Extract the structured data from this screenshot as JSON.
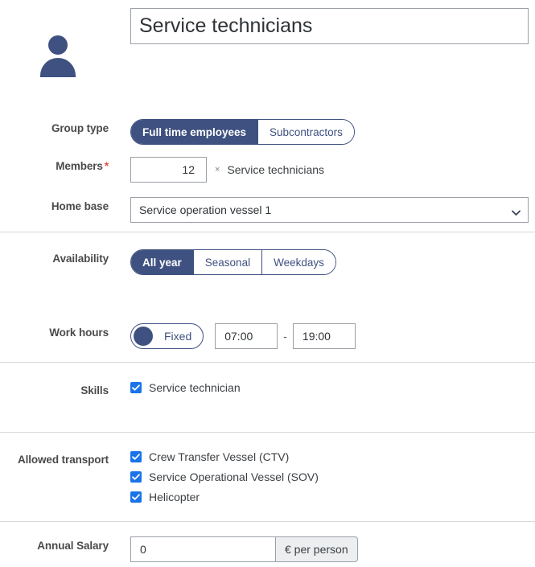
{
  "header": {
    "avatar_icon": "person-icon",
    "group_name": "Service technicians"
  },
  "fields": {
    "group_type": {
      "label": "Group type",
      "options": [
        "Full time employees",
        "Subcontractors"
      ],
      "selected": "Full time employees"
    },
    "members": {
      "label": "Members",
      "required_marker": "*",
      "value": "12",
      "multiplier": "×",
      "unit": "Service technicians"
    },
    "home_base": {
      "label": "Home base",
      "value": "Service operation vessel 1",
      "chevron_icon": "chevron-down-icon"
    },
    "availability": {
      "label": "Availability",
      "options": [
        "All year",
        "Seasonal",
        "Weekdays"
      ],
      "selected": "All year"
    },
    "work_hours": {
      "label": "Work hours",
      "toggle_label": "Fixed",
      "toggle_on": true,
      "start_time": "07:00",
      "end_time": "19:00",
      "separator": "-"
    },
    "skills": {
      "label": "Skills",
      "items": [
        {
          "label": "Service technician",
          "checked": true
        }
      ]
    },
    "allowed_transport": {
      "label": "Allowed transport",
      "items": [
        {
          "label": "Crew Transfer Vessel (CTV)",
          "checked": true
        },
        {
          "label": "Service Operational Vessel (SOV)",
          "checked": true
        },
        {
          "label": "Helicopter",
          "checked": true
        }
      ]
    },
    "annual_salary": {
      "label": "Annual Salary",
      "value": "0",
      "addon": "€ per person"
    }
  },
  "colors": {
    "brand_navy": "#3f5180",
    "checkbox_blue": "#1a73e8",
    "required_red": "#e8483f",
    "border_gray": "#9aa0a6",
    "divider_gray": "#d6d8db"
  }
}
